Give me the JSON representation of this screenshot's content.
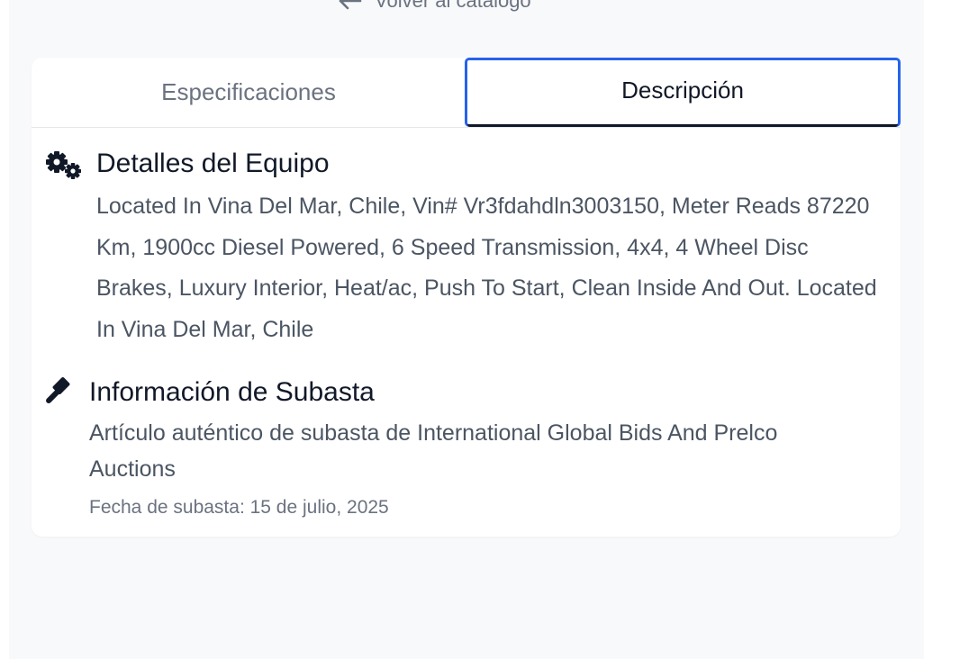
{
  "nav": {
    "back_label": "Volver al catálogo"
  },
  "tabs": [
    {
      "label": "Especificaciones",
      "active": false
    },
    {
      "label": "Descripción",
      "active": true
    }
  ],
  "equipment_details": {
    "icon": "gears-icon",
    "title": "Detalles del Equipo",
    "description": "Located In Vina Del Mar, Chile, Vin# Vr3fdahdln3003150, Meter Reads 87220 Km, 1900cc Diesel Powered, 6 Speed Transmission, 4x4, 4 Wheel Disc Brakes, Luxury Interior, Heat/ac, Push To Start, Clean Inside And Out. Located In Vina Del Mar, Chile"
  },
  "auction_info": {
    "icon": "gavel-icon",
    "title": "Información de Subasta",
    "description": "Artículo auténtico de subasta de International Global Bids And Prelco Auctions",
    "date": "Fecha de subasta: 15 de julio, 2025"
  },
  "colors": {
    "accent": "#2563eb",
    "page_bg": "#f8f9fb",
    "card_bg": "#ffffff",
    "text_primary": "#111827",
    "text_secondary": "#4b5563",
    "text_muted": "#6b7280"
  }
}
